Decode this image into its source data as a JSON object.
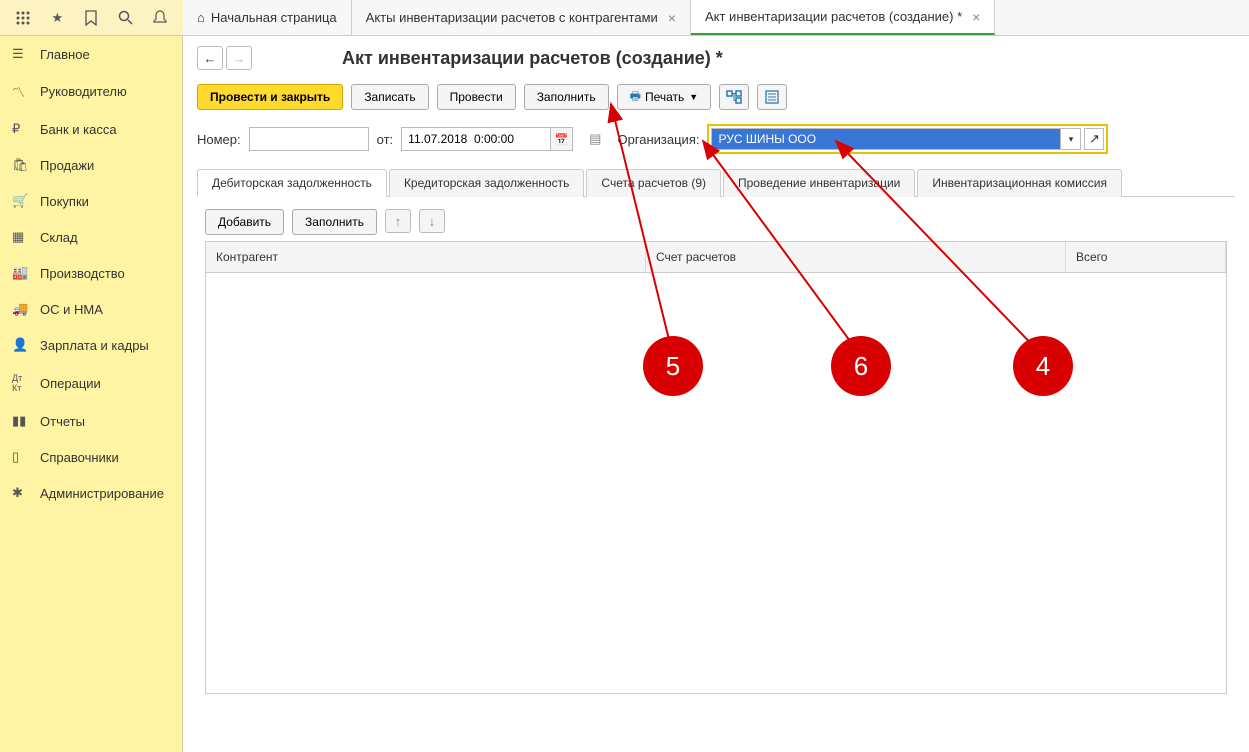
{
  "topbar_icons": [
    "apps",
    "star",
    "bookmark",
    "search",
    "bell"
  ],
  "sidebar": {
    "items": [
      {
        "icon": "menu",
        "label": "Главное"
      },
      {
        "icon": "chart",
        "label": "Руководителю"
      },
      {
        "icon": "bank",
        "label": "Банк и касса"
      },
      {
        "icon": "bag",
        "label": "Продажи"
      },
      {
        "icon": "cart",
        "label": "Покупки"
      },
      {
        "icon": "boxes",
        "label": "Склад"
      },
      {
        "icon": "factory",
        "label": "Производство"
      },
      {
        "icon": "truck",
        "label": "ОС и НМА"
      },
      {
        "icon": "person",
        "label": "Зарплата и кадры"
      },
      {
        "icon": "ops",
        "label": "Операции"
      },
      {
        "icon": "bars",
        "label": "Отчеты"
      },
      {
        "icon": "book",
        "label": "Справочники"
      },
      {
        "icon": "gear",
        "label": "Администрирование"
      }
    ]
  },
  "tabs": [
    {
      "label": "Начальная страница",
      "home": true,
      "closable": false
    },
    {
      "label": "Акты инвентаризации расчетов с контрагентами",
      "closable": true
    },
    {
      "label": "Акт инвентаризации расчетов (создание) *",
      "closable": true,
      "active": true
    }
  ],
  "page_title": "Акт инвентаризации расчетов (создание) *",
  "toolbar": {
    "post_close": "Провести и закрыть",
    "write": "Записать",
    "post": "Провести",
    "fill": "Заполнить",
    "print": "Печать"
  },
  "form": {
    "number_label": "Номер:",
    "number_value": "",
    "from_label": "от:",
    "date_value": "11.07.2018  0:00:00",
    "org_label": "Организация:",
    "org_value": "РУС ШИНЫ ООО"
  },
  "subtabs": [
    "Дебиторская задолженность",
    "Кредиторская задолженность",
    "Счета расчетов (9)",
    "Проведение инвентаризации",
    "Инвентаризационная комиссия"
  ],
  "table_toolbar": {
    "add": "Добавить",
    "fill": "Заполнить"
  },
  "table_headers": {
    "counterparty": "Контрагент",
    "account": "Счет расчетов",
    "total": "Всего"
  },
  "annotations": {
    "a5": "5",
    "a6": "6",
    "a4": "4"
  }
}
